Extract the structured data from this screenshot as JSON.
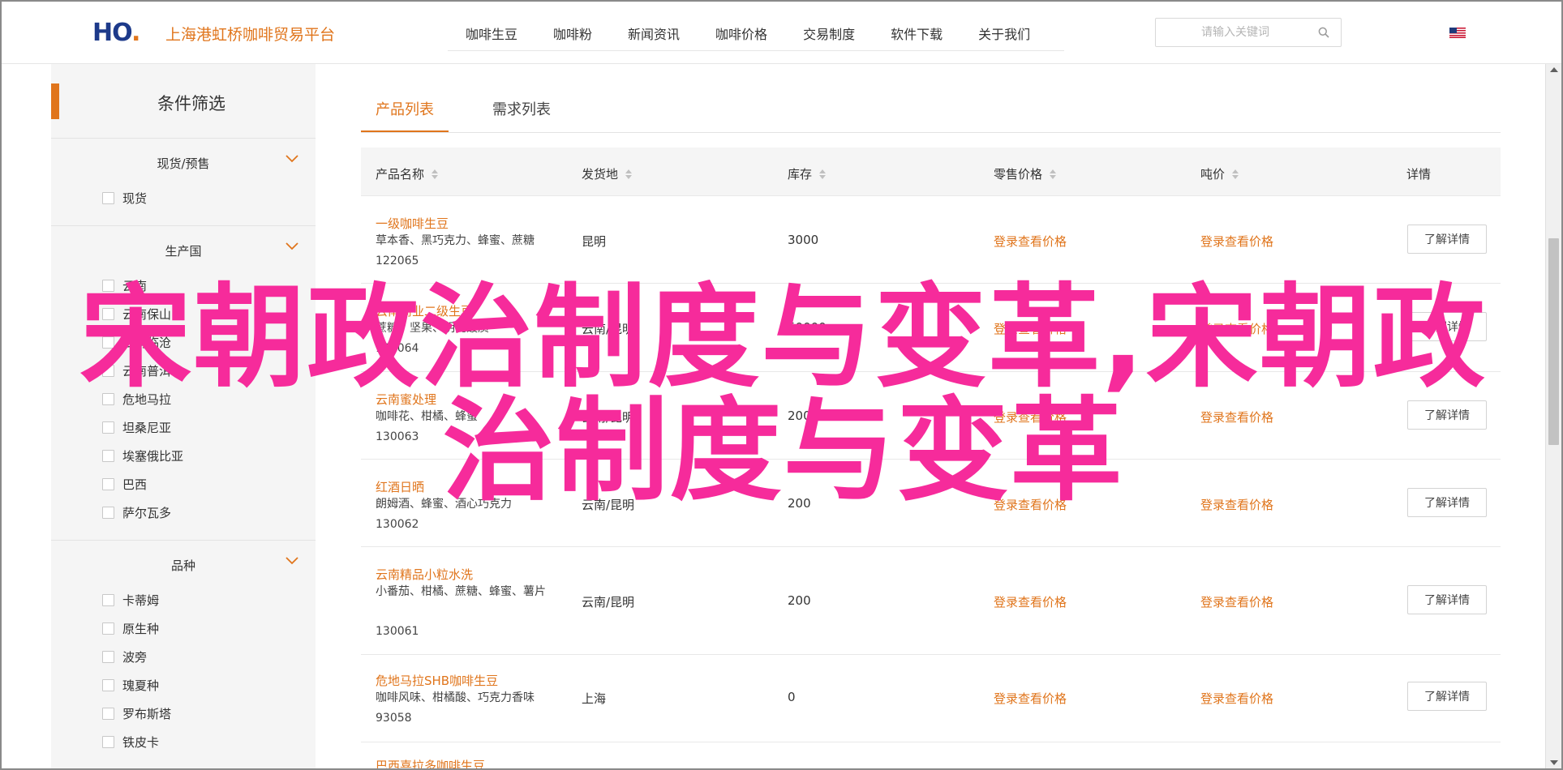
{
  "header": {
    "logo_text_h": "H",
    "logo_text_o": "O",
    "logo_text_dot": ".",
    "site_name": "上海港虹桥咖啡贸易平台",
    "nav": [
      "咖啡生豆",
      "咖啡粉",
      "新闻资讯",
      "咖啡价格",
      "交易制度",
      "软件下载",
      "关于我们"
    ],
    "search_placeholder": "请输入关键词",
    "flag_icon": "us-flag-icon"
  },
  "sidebar": {
    "title": "条件筛选",
    "groups": [
      {
        "label": "现货/预售",
        "options": [
          "现货"
        ]
      },
      {
        "label": "生产国",
        "options": [
          "云南",
          "云南保山",
          "云南临沧",
          "云南普洱",
          "危地马拉",
          "坦桑尼亚",
          "埃塞俄比亚",
          "巴西",
          "萨尔瓦多"
        ]
      },
      {
        "label": "品种",
        "options": [
          "卡蒂姆",
          "原生种",
          "波旁",
          "瑰夏种",
          "罗布斯塔",
          "铁皮卡"
        ]
      }
    ]
  },
  "tabs": [
    "产品列表",
    "需求列表"
  ],
  "table": {
    "headers": [
      "产品名称",
      "发货地",
      "库存",
      "零售价格",
      "吨价",
      "详情"
    ],
    "rows": [
      {
        "name": "一级咖啡生豆",
        "desc": "草本香、黑巧克力、蜂蜜、蔗糖",
        "id": "122065",
        "origin": "昆明",
        "stock": "3000",
        "retail": "登录查看价格",
        "ton": "登录查看价格",
        "btn": "了解详情"
      },
      {
        "name": "云南商业二级生豆",
        "desc": "蔗糖、坚果、明亮酸质",
        "id": "130064",
        "origin": "云南/昆明",
        "stock": "50000",
        "retail": "登录查看价格",
        "ton": "登录查看价格",
        "btn": "了解详情"
      },
      {
        "name": "云南蜜处理",
        "desc": "咖啡花、柑橘、蜂蜜",
        "id": "130063",
        "origin": "云南/昆明",
        "stock": "200",
        "retail": "登录查看价格",
        "ton": "登录查看价格",
        "btn": "了解详情"
      },
      {
        "name": "红酒日晒",
        "desc": "朗姆酒、蜂蜜、酒心巧克力",
        "id": "130062",
        "origin": "云南/昆明",
        "stock": "200",
        "retail": "登录查看价格",
        "ton": "登录查看价格",
        "btn": "了解详情"
      },
      {
        "name": "云南精品小粒水洗",
        "desc": "小番茄、柑橘、蔗糖、蜂蜜、薯片",
        "id": "130061",
        "origin": "云南/昆明",
        "stock": "200",
        "retail": "登录查看价格",
        "ton": "登录查看价格",
        "btn": "了解详情"
      },
      {
        "name": "危地马拉SHB咖啡生豆",
        "desc": "咖啡风味、柑橘酸、巧克力香味",
        "id": "93058",
        "origin": "上海",
        "stock": "0",
        "retail": "登录查看价格",
        "ton": "登录查看价格",
        "btn": "了解详情"
      },
      {
        "name": "巴西喜拉多咖啡生豆",
        "desc": "",
        "id": "",
        "origin": "",
        "stock": "",
        "retail": "",
        "ton": "",
        "btn": ""
      }
    ]
  },
  "overlay": {
    "line1": "宋朝政治制度与变革,宋朝政",
    "line2": "治制度与变革"
  },
  "colors": {
    "accent": "#e0751c",
    "overlay": "#f62b9b",
    "logo_blue": "#1d3a8a"
  }
}
